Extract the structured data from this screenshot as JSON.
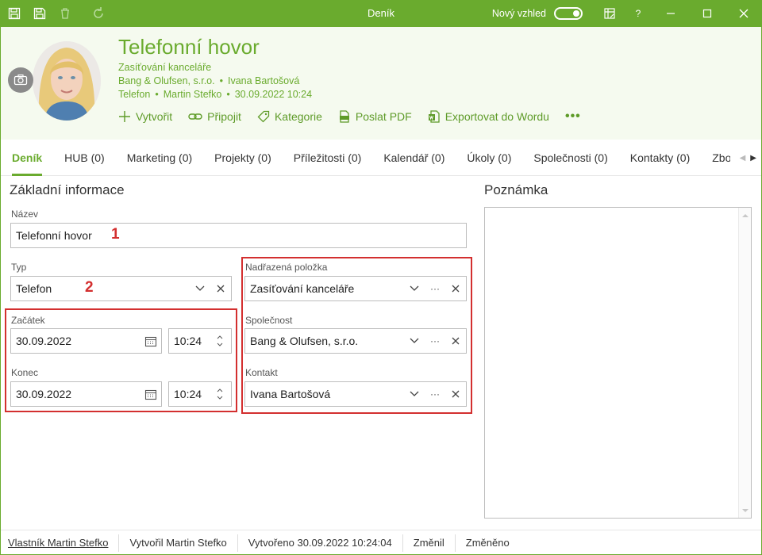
{
  "titlebar": {
    "title": "Deník",
    "new_look": "Nový vzhled",
    "help": "?"
  },
  "header": {
    "title": "Telefonní hovor",
    "line1": "Zasíťování kanceláře",
    "company": "Bang & Olufsen, s.r.o.",
    "contact": "Ivana Bartošová",
    "type": "Telefon",
    "owner": "Martin Stefko",
    "datetime": "30.09.2022 10:24",
    "separator": "•",
    "actions": {
      "create": "Vytvořit",
      "attach": "Připojit",
      "category": "Kategorie",
      "send_pdf": "Poslat PDF",
      "export_word": "Exportovat do Wordu",
      "more": "•••"
    }
  },
  "tabs": [
    {
      "label": "Deník"
    },
    {
      "label": "HUB (0)"
    },
    {
      "label": "Marketing (0)"
    },
    {
      "label": "Projekty (0)"
    },
    {
      "label": "Příležitosti (0)"
    },
    {
      "label": "Kalendář (0)"
    },
    {
      "label": "Úkoly (0)"
    },
    {
      "label": "Společnosti (0)"
    },
    {
      "label": "Kontakty (0)"
    },
    {
      "label": "Zboží"
    }
  ],
  "basic": {
    "title": "Základní informace",
    "name_label": "Název",
    "name_value": "Telefonní hovor",
    "type_label": "Typ",
    "type_value": "Telefon",
    "start_label": "Začátek",
    "start_date": "30.09.2022",
    "start_time": "10:24",
    "end_label": "Konec",
    "end_date": "30.09.2022",
    "end_time": "10:24"
  },
  "relations": {
    "parent_label": "Nadřazená položka",
    "parent_value": "Zasíťování kanceláře",
    "company_label": "Společnost",
    "company_value": "Bang & Olufsen, s.r.o.",
    "contact_label": "Kontakt",
    "contact_value": "Ivana Bartošová",
    "more_glyph": "···"
  },
  "annotations": {
    "one": "1",
    "two": "2"
  },
  "notes": {
    "title": "Poznámka"
  },
  "footer": {
    "owner": "Vlastník Martin Stefko",
    "created_by": "Vytvořil Martin Stefko",
    "created": "Vytvořeno 30.09.2022 10:24:04",
    "changed_by": "Změnil",
    "changed": "Změněno"
  },
  "colors": {
    "accent": "#6aab2e",
    "highlight": "#d32f2f"
  }
}
